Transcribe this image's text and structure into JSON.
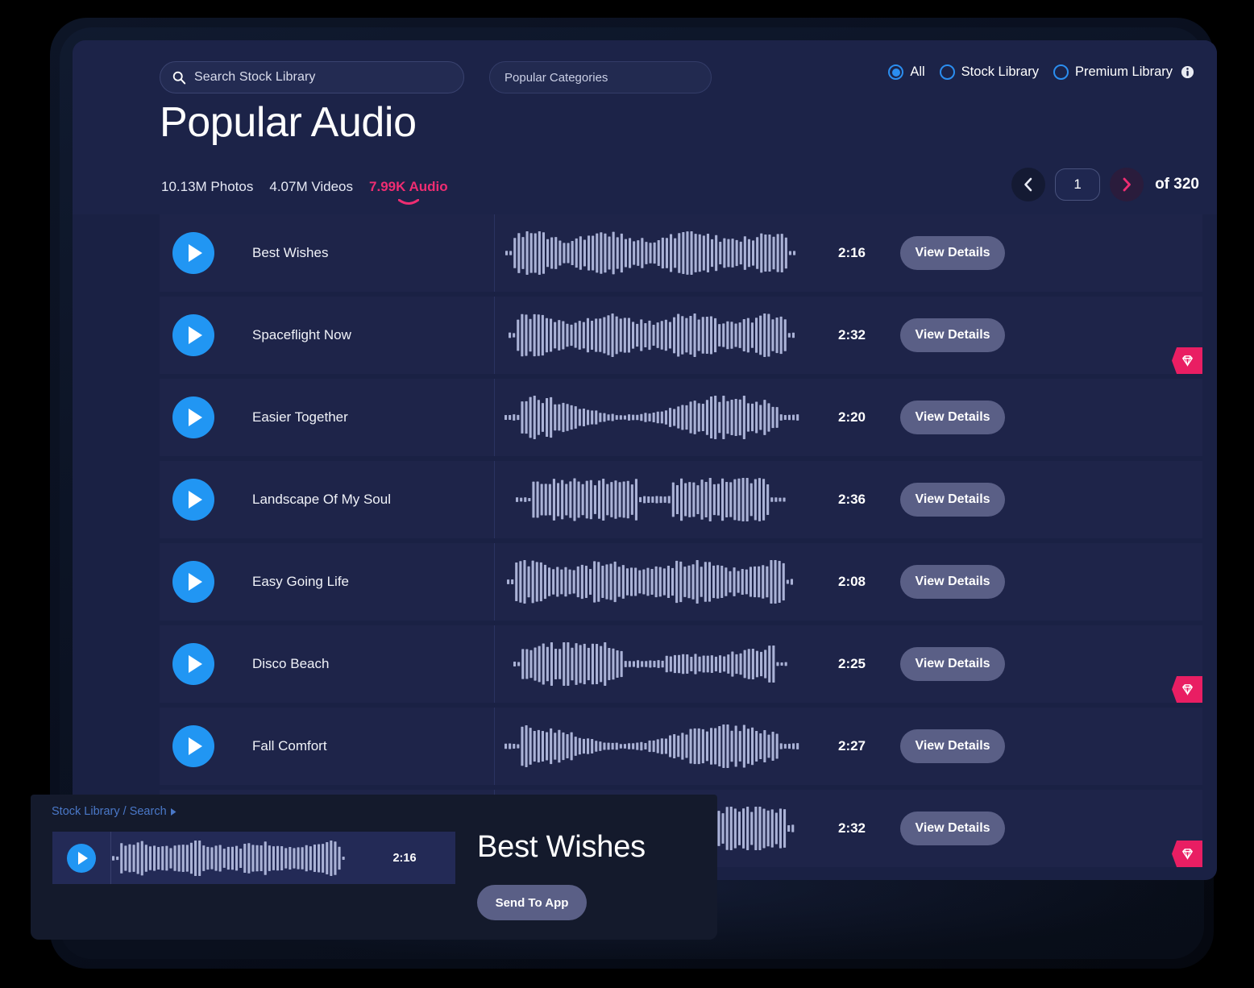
{
  "header": {
    "search": {
      "placeholder": "Search Stock Library",
      "value": "",
      "icon": "search-icon"
    },
    "categories": {
      "label": "Popular Categories"
    },
    "filters": {
      "options": [
        {
          "label": "All",
          "selected": true
        },
        {
          "label": "Stock Library",
          "selected": false
        },
        {
          "label": "Premium Library",
          "selected": false
        }
      ],
      "info_icon": "info-icon"
    },
    "title": "Popular Audio",
    "stats": [
      {
        "label": "10.13M Photos",
        "active": false
      },
      {
        "label": "4.07M Videos",
        "active": false
      },
      {
        "label": "7.99K Audio",
        "active": true
      }
    ],
    "pagination": {
      "prev_icon": "chevron-left-icon",
      "page_value": "1",
      "next_icon": "chevron-right-icon",
      "total_label": "of 320"
    }
  },
  "tracks": [
    {
      "title": "Best Wishes",
      "duration": "2:16",
      "action": "View Details",
      "premium": false
    },
    {
      "title": "Spaceflight Now",
      "duration": "2:32",
      "action": "View Details",
      "premium": true
    },
    {
      "title": "Easier Together",
      "duration": "2:20",
      "action": "View Details",
      "premium": false
    },
    {
      "title": "Landscape Of My Soul",
      "duration": "2:36",
      "action": "View Details",
      "premium": false
    },
    {
      "title": "Easy Going Life",
      "duration": "2:08",
      "action": "View Details",
      "premium": false
    },
    {
      "title": "Disco Beach",
      "duration": "2:25",
      "action": "View Details",
      "premium": true
    },
    {
      "title": "Fall Comfort",
      "duration": "2:27",
      "action": "View Details",
      "premium": false
    },
    {
      "title": "",
      "duration": "2:32",
      "action": "View Details",
      "premium": true
    }
  ],
  "track_badges": {
    "2": true,
    "4": true,
    "6": true,
    "8": true
  },
  "overlay": {
    "breadcrumb": "Stock Library / Search",
    "player": {
      "duration": "2:16"
    },
    "title": "Best Wishes",
    "send_button": "Send To App"
  },
  "colors": {
    "accent_pink": "#ef2d72",
    "play_blue": "#2196f3",
    "radio_blue": "#2b8ef0",
    "button_slate": "#5a5f86",
    "row_bg": "#1e2449",
    "app_bg": "#1a2144",
    "waveform": "#aab2d6",
    "breadcrumb_link": "#4a78c8"
  }
}
